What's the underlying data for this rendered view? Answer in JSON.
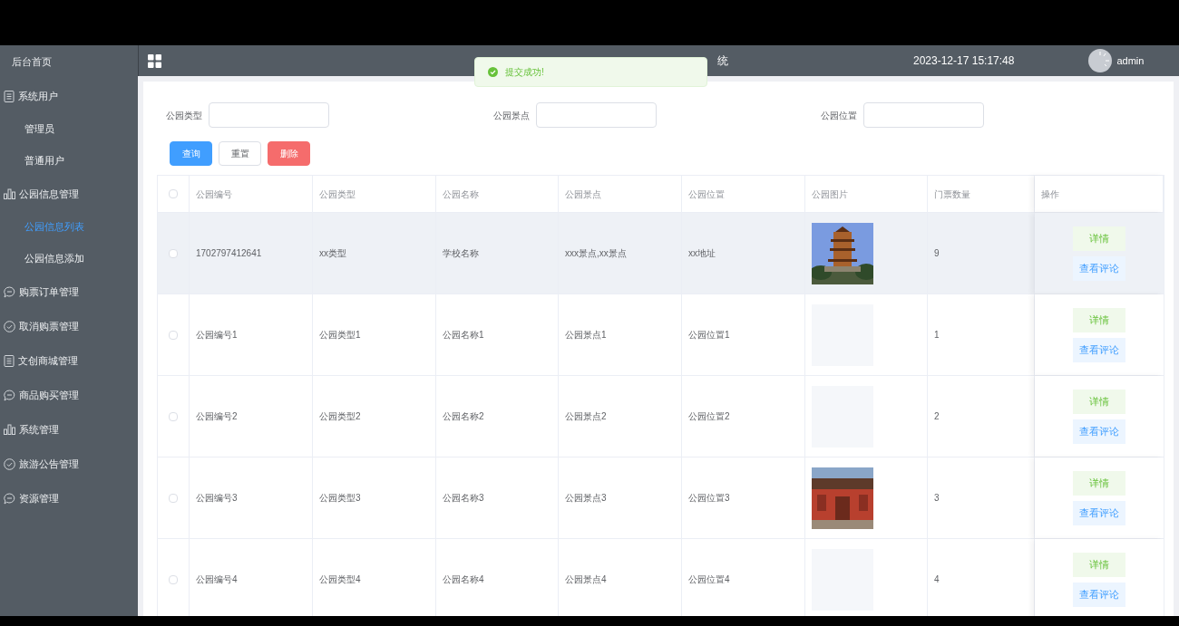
{
  "sidebar": {
    "home": "后台首页",
    "items": [
      {
        "label": "系统用户",
        "children": [
          {
            "label": "管理员",
            "selected": false
          },
          {
            "label": "普通用户",
            "selected": false
          }
        ]
      },
      {
        "label": "公园信息管理",
        "children": [
          {
            "label": "公园信息列表",
            "selected": true
          },
          {
            "label": "公园信息添加",
            "selected": false
          }
        ]
      },
      {
        "label": "购票订单管理"
      },
      {
        "label": "取消购票管理"
      },
      {
        "label": "文创商城管理"
      },
      {
        "label": "商品购买管理"
      },
      {
        "label": "系统管理"
      },
      {
        "label": "旅游公告管理"
      },
      {
        "label": "资源管理"
      }
    ]
  },
  "header": {
    "title": "统",
    "datetime": "2023-12-17 15:17:48",
    "user": "admin"
  },
  "toast": {
    "message": "提交成功!"
  },
  "filters": [
    {
      "label": "公园类型"
    },
    {
      "label": "公园景点"
    },
    {
      "label": "公园位置"
    }
  ],
  "buttons": [
    {
      "label": "查询",
      "kind": "primary"
    },
    {
      "label": "重置",
      "kind": "default"
    },
    {
      "label": "删除",
      "kind": "danger"
    }
  ],
  "table": {
    "all_checked": false,
    "columns": [
      "公园编号",
      "公园类型",
      "公园名称",
      "公园景点",
      "公园位置",
      "公园图片",
      "门票数量",
      "操作"
    ],
    "rows": [
      {
        "checked": false,
        "hover": true,
        "cells": [
          "1702797412641",
          "xx类型",
          "学校名称",
          "xxx景点,xx景点",
          "xx地址"
        ],
        "image": {
          "kind": "picture"
        },
        "count": "9",
        "actions": [
          "详情",
          "查看评论"
        ]
      },
      {
        "checked": false,
        "hover": false,
        "cells": [
          "公园编号1",
          "公园类型1",
          "公园名称1",
          "公园景点1",
          "公园位置1"
        ],
        "image": {
          "kind": "placeholder"
        },
        "count": "1",
        "actions": [
          "详情",
          "查看评论"
        ]
      },
      {
        "checked": false,
        "hover": false,
        "cells": [
          "公园编号2",
          "公园类型2",
          "公园名称2",
          "公园景点2",
          "公园位置2"
        ],
        "image": {
          "kind": "placeholder"
        },
        "count": "2",
        "actions": [
          "详情",
          "查看评论"
        ]
      },
      {
        "checked": false,
        "hover": false,
        "cells": [
          "公园编号3",
          "公园类型3",
          "公园名称3",
          "公园景点3",
          "公园位置3"
        ],
        "image": {
          "kind": "picture"
        },
        "count": "3",
        "actions": [
          "详情",
          "查看评论"
        ]
      },
      {
        "checked": false,
        "hover": false,
        "cells": [
          "公园编号4",
          "公园类型4",
          "公园名称4",
          "公园景点4",
          "公园位置4"
        ],
        "image": {
          "kind": "placeholder"
        },
        "count": "4",
        "actions": [
          "详情",
          "查看评论"
        ]
      }
    ]
  }
}
